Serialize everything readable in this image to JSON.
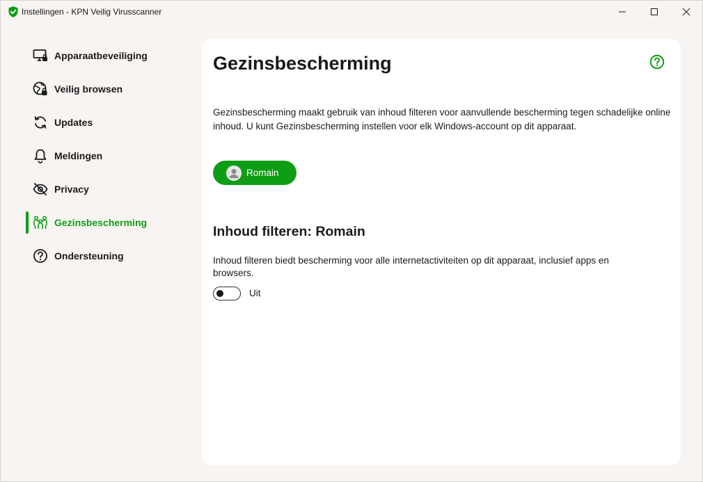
{
  "window": {
    "title": "Instellingen - KPN Veilig Virusscanner",
    "controls": [
      "minimize",
      "maximize",
      "close"
    ]
  },
  "sidebar": {
    "items": [
      {
        "label": "Apparaatbeveiliging",
        "icon": "monitor-lock-icon",
        "active": false
      },
      {
        "label": "Veilig browsen",
        "icon": "globe-lock-icon",
        "active": false
      },
      {
        "label": "Updates",
        "icon": "refresh-icon",
        "active": false
      },
      {
        "label": "Meldingen",
        "icon": "bell-icon",
        "active": false
      },
      {
        "label": "Privacy",
        "icon": "eye-off-icon",
        "active": false
      },
      {
        "label": "Gezinsbescherming",
        "icon": "family-icon",
        "active": true
      },
      {
        "label": "Ondersteuning",
        "icon": "question-icon",
        "active": false
      }
    ]
  },
  "main": {
    "title": "Gezinsbescherming",
    "intro": "Gezinsbescherming maakt gebruik van inhoud filteren voor aanvullende bescherming tegen schadelijke online inhoud. U kunt Gezinsbescherming instellen voor elk Windows-account op dit apparaat.",
    "user_button": {
      "name": "Romain",
      "icon": "user-avatar-icon"
    },
    "section_title": "Inhoud filteren: Romain",
    "section_desc": "Inhoud filteren biedt bescherming voor alle internetactiviteiten op dit apparaat, inclusief apps en browsers.",
    "toggle": {
      "state": "off",
      "label": "Uit"
    }
  },
  "colors": {
    "accent": "#0f9d15",
    "background": "#f7f4f2",
    "card": "#ffffff",
    "text": "#1a1a1a"
  }
}
